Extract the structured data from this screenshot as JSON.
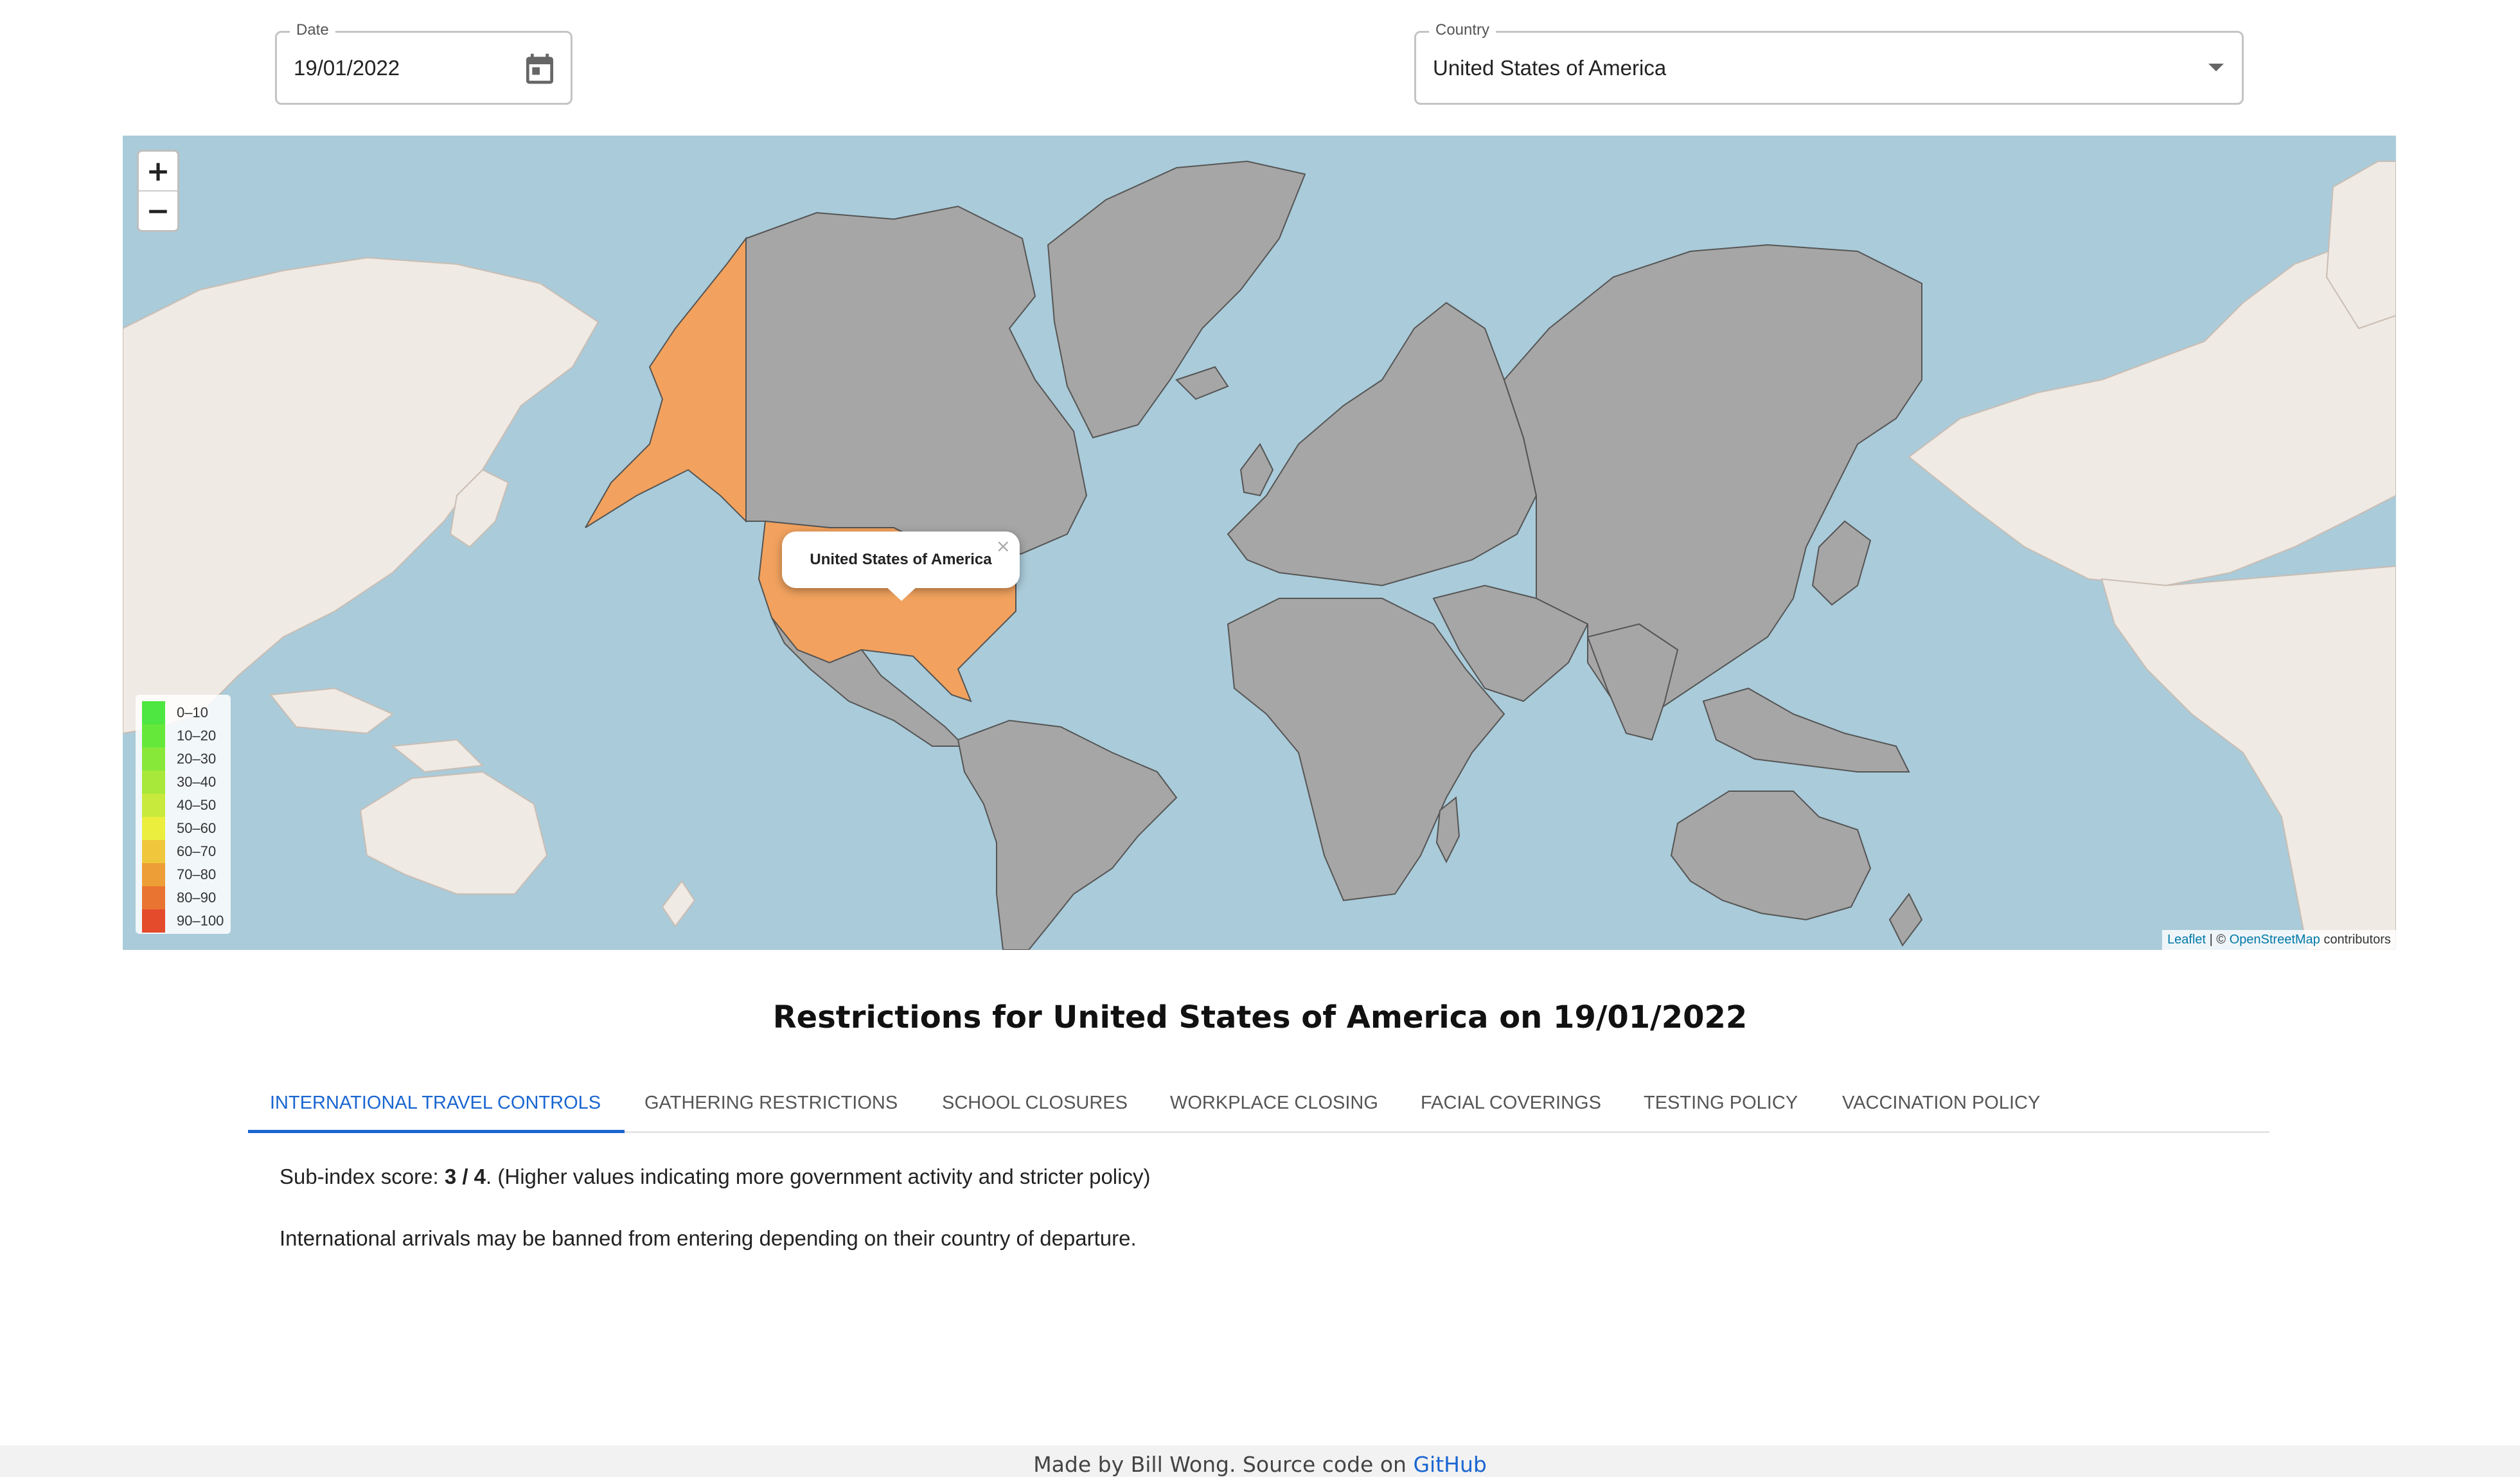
{
  "date_field": {
    "label": "Date",
    "value": "19/01/2022",
    "icon": "calendar-icon"
  },
  "country_field": {
    "label": "Country",
    "value": "United States of America",
    "icon": "chevron-down-icon"
  },
  "map": {
    "zoom_in": "+",
    "zoom_out": "−",
    "popup": {
      "text": "United States of America",
      "close": "×"
    },
    "highlight_color": "#f2a25e",
    "land_color": "#a6a6a6",
    "ocean_color": "#aacbd9",
    "basemap_land_color": "#efeae3",
    "legend": [
      {
        "label": "0–10",
        "color": "#4ee640"
      },
      {
        "label": "10–20",
        "color": "#66e83b"
      },
      {
        "label": "20–30",
        "color": "#87e83a"
      },
      {
        "label": "30–40",
        "color": "#a7e83a"
      },
      {
        "label": "40–50",
        "color": "#c8ea3d"
      },
      {
        "label": "50–60",
        "color": "#ecee3e"
      },
      {
        "label": "60–70",
        "color": "#f0c73c"
      },
      {
        "label": "70–80",
        "color": "#ee9e36"
      },
      {
        "label": "80–90",
        "color": "#e97431"
      },
      {
        "label": "90–100",
        "color": "#e44a2c"
      }
    ],
    "attribution": {
      "leaflet": "Leaflet",
      "separator": " | © ",
      "osm": "OpenStreetMap",
      "suffix": " contributors"
    }
  },
  "heading": "Restrictions for United States of America on 19/01/2022",
  "tabs": [
    {
      "label": "INTERNATIONAL TRAVEL CONTROLS",
      "active": true
    },
    {
      "label": "GATHERING RESTRICTIONS",
      "active": false
    },
    {
      "label": "SCHOOL CLOSURES",
      "active": false
    },
    {
      "label": "WORKPLACE CLOSING",
      "active": false
    },
    {
      "label": "FACIAL COVERINGS",
      "active": false
    },
    {
      "label": "TESTING POLICY",
      "active": false
    },
    {
      "label": "VACCINATION POLICY",
      "active": false
    }
  ],
  "content": {
    "score_prefix": "Sub-index score: ",
    "score": "3 / 4",
    "score_suffix": ". (Higher values indicating more government activity and stricter policy)",
    "description": "International arrivals may be banned from entering depending on their country of departure."
  },
  "footer": {
    "text": "Made by Bill Wong. Source code on ",
    "link": "GitHub"
  }
}
